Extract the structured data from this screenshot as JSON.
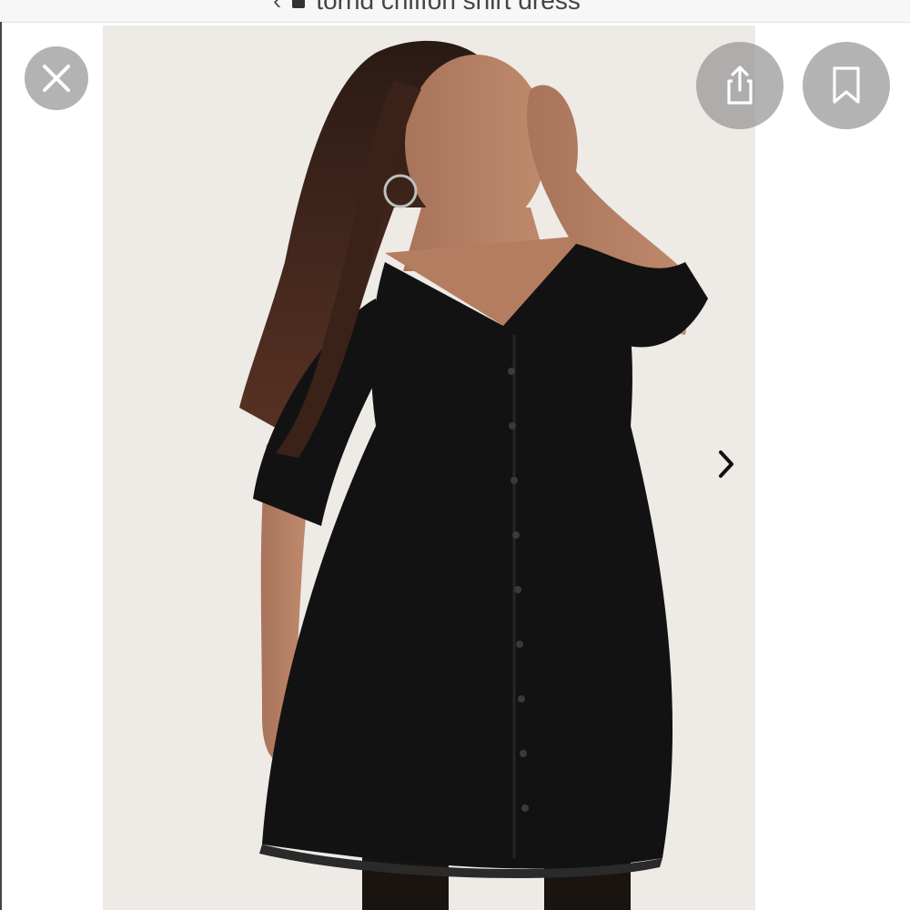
{
  "browser": {
    "search_query": "torrid chiffon shirt dress"
  },
  "viewer": {
    "close_icon": "close-icon",
    "share_icon": "share-icon",
    "bookmark_icon": "bookmark-icon",
    "next_icon": "chevron-right-icon",
    "photo_background": "#eeeae6",
    "dress_color": "#121212",
    "button_color": "#969696"
  }
}
